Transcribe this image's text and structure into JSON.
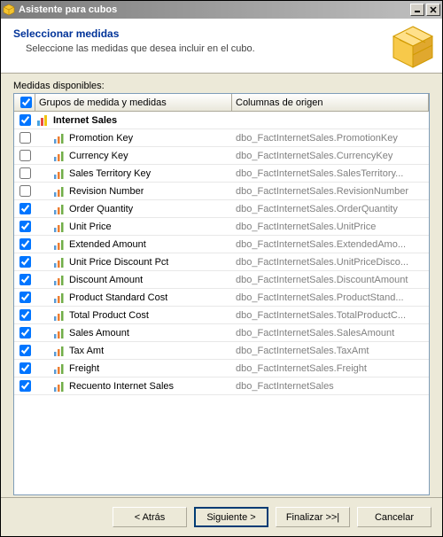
{
  "window": {
    "title": "Asistente para cubos"
  },
  "banner": {
    "heading": "Seleccionar medidas",
    "subtext": "Seleccione las medidas que desea incluir en el cubo."
  },
  "list_label": "Medidas disponibles:",
  "columns": {
    "name": "Grupos de medida y medidas",
    "source": "Columnas de origen"
  },
  "header_checked": true,
  "rows": [
    {
      "checked": true,
      "type": "group",
      "name": "Internet Sales",
      "source": ""
    },
    {
      "checked": false,
      "type": "measure",
      "name": "Promotion Key",
      "source": "dbo_FactInternetSales.PromotionKey"
    },
    {
      "checked": false,
      "type": "measure",
      "name": "Currency Key",
      "source": "dbo_FactInternetSales.CurrencyKey"
    },
    {
      "checked": false,
      "type": "measure",
      "name": "Sales Territory Key",
      "source": "dbo_FactInternetSales.SalesTerritory..."
    },
    {
      "checked": false,
      "type": "measure",
      "name": "Revision Number",
      "source": "dbo_FactInternetSales.RevisionNumber"
    },
    {
      "checked": true,
      "type": "measure",
      "name": "Order Quantity",
      "source": "dbo_FactInternetSales.OrderQuantity"
    },
    {
      "checked": true,
      "type": "measure",
      "name": "Unit Price",
      "source": "dbo_FactInternetSales.UnitPrice"
    },
    {
      "checked": true,
      "type": "measure",
      "name": "Extended Amount",
      "source": "dbo_FactInternetSales.ExtendedAmo..."
    },
    {
      "checked": true,
      "type": "measure",
      "name": "Unit Price Discount Pct",
      "source": "dbo_FactInternetSales.UnitPriceDisco..."
    },
    {
      "checked": true,
      "type": "measure",
      "name": "Discount Amount",
      "source": "dbo_FactInternetSales.DiscountAmount"
    },
    {
      "checked": true,
      "type": "measure",
      "name": "Product Standard Cost",
      "source": "dbo_FactInternetSales.ProductStand..."
    },
    {
      "checked": true,
      "type": "measure",
      "name": "Total Product Cost",
      "source": "dbo_FactInternetSales.TotalProductC..."
    },
    {
      "checked": true,
      "type": "measure",
      "name": "Sales Amount",
      "source": "dbo_FactInternetSales.SalesAmount"
    },
    {
      "checked": true,
      "type": "measure",
      "name": "Tax Amt",
      "source": "dbo_FactInternetSales.TaxAmt"
    },
    {
      "checked": true,
      "type": "measure",
      "name": "Freight",
      "source": "dbo_FactInternetSales.Freight"
    },
    {
      "checked": true,
      "type": "measure",
      "name": "Recuento Internet Sales",
      "source": "dbo_FactInternetSales"
    }
  ],
  "nav": {
    "back": "< Atrás",
    "next": "Siguiente >",
    "finish": "Finalizar >>|",
    "cancel": "Cancelar"
  },
  "icons": {
    "app": "cube-icon",
    "group": "measure-group-icon",
    "measure": "measure-icon"
  }
}
